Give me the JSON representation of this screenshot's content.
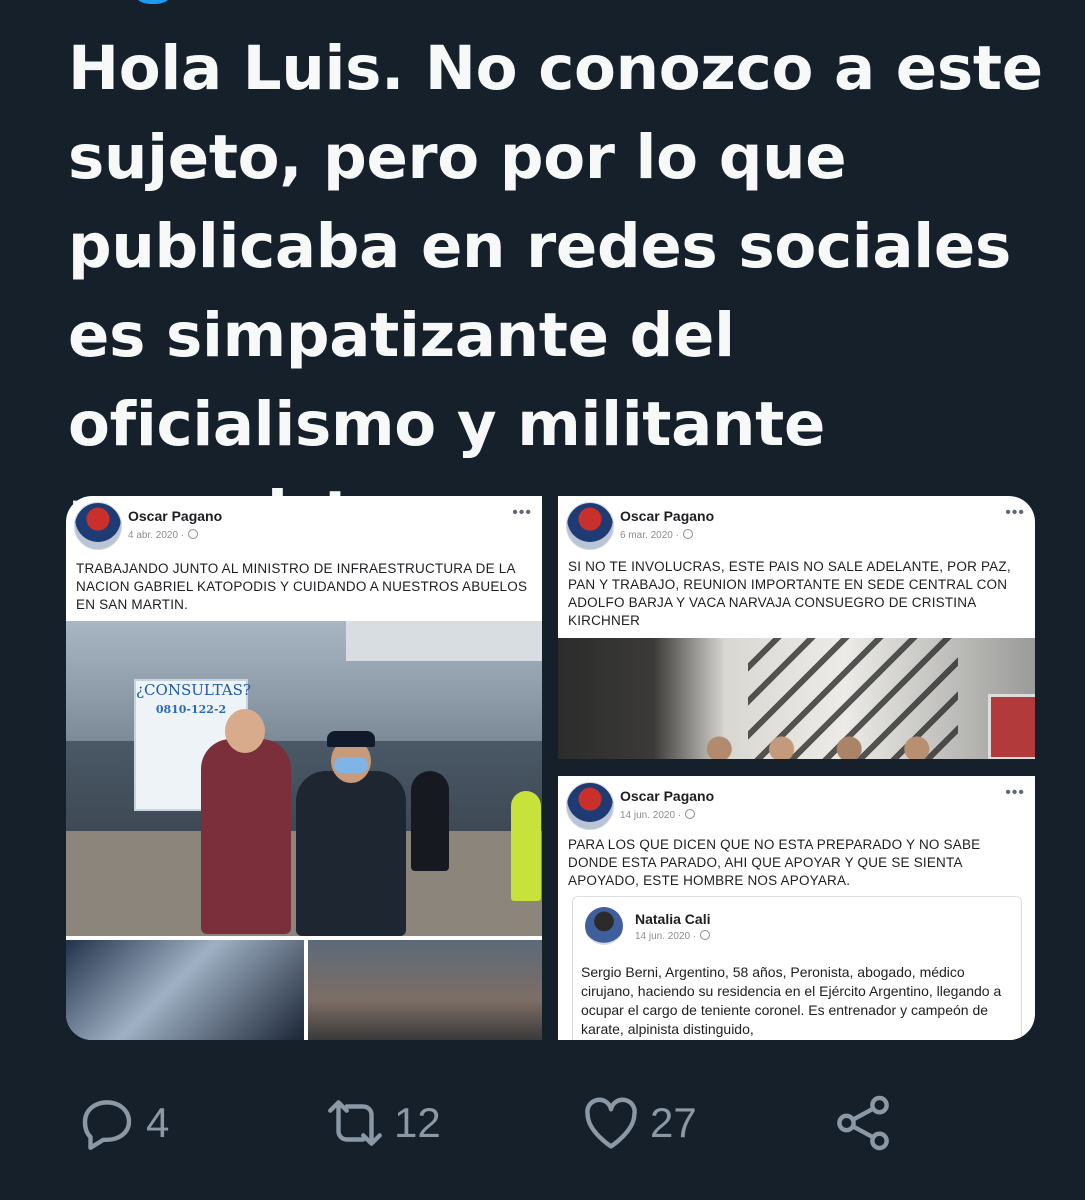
{
  "tweet": {
    "text": "Hola Luis. No conozco a este sujeto, pero por lo que publicaba en redes sociales es simpatizante del oficialismo y militante peronista."
  },
  "posts": [
    {
      "author": "Oscar Pagano",
      "date": "4 abr. 2020 ·",
      "text": "TRABAJANDO JUNTO AL MINISTRO DE INFRAESTRUCTURA DE LA NACION GABRIEL KATOPODIS Y CUIDANDO A NUESTROS ABUELOS EN SAN MARTIN.",
      "photo_sign": "¿CONSULTAS?",
      "photo_sign_phone": "0810-122-2"
    },
    {
      "author": "Oscar Pagano",
      "date": "6 mar. 2020 ·",
      "text": "SI NO TE INVOLUCRAS, ESTE PAIS NO SALE ADELANTE, POR PAZ, PAN Y TRABAJO, REUNION IMPORTANTE EN SEDE CENTRAL CON ADOLFO BARJA Y VACA NARVAJA CONSUEGRO DE CRISTINA KIRCHNER"
    },
    {
      "author": "Oscar Pagano",
      "date": "14 jun. 2020 ·",
      "text": "PARA LOS QUE DICEN QUE NO ESTA PREPARADO Y NO SABE DONDE ESTA PARADO, AHI QUE APOYAR Y QUE SE SIENTA APOYADO, ESTE HOMBRE NOS APOYARA.",
      "shared": {
        "author": "Natalia Cali",
        "date": "14 jun. 2020 ·",
        "text": "Sergio Berni, Argentino, 58 años, Peronista, abogado, médico cirujano,  haciendo su residencia en el Ejército Argentino, llegando a ocupar el cargo de teniente coronel. Es entrenador y campeón de karate, alpinista distinguido,"
      }
    }
  ],
  "more_glyph": "•••",
  "actions": {
    "replies": "4",
    "retweets": "12",
    "likes": "27"
  },
  "colors": {
    "background": "#15202b",
    "text": "#f7f9f9",
    "icon": "#8b98a5",
    "accent": "#1d9bf0"
  },
  "icons": [
    "reply-icon",
    "retweet-icon",
    "like-icon",
    "share-icon",
    "globe-icon",
    "more-icon"
  ]
}
